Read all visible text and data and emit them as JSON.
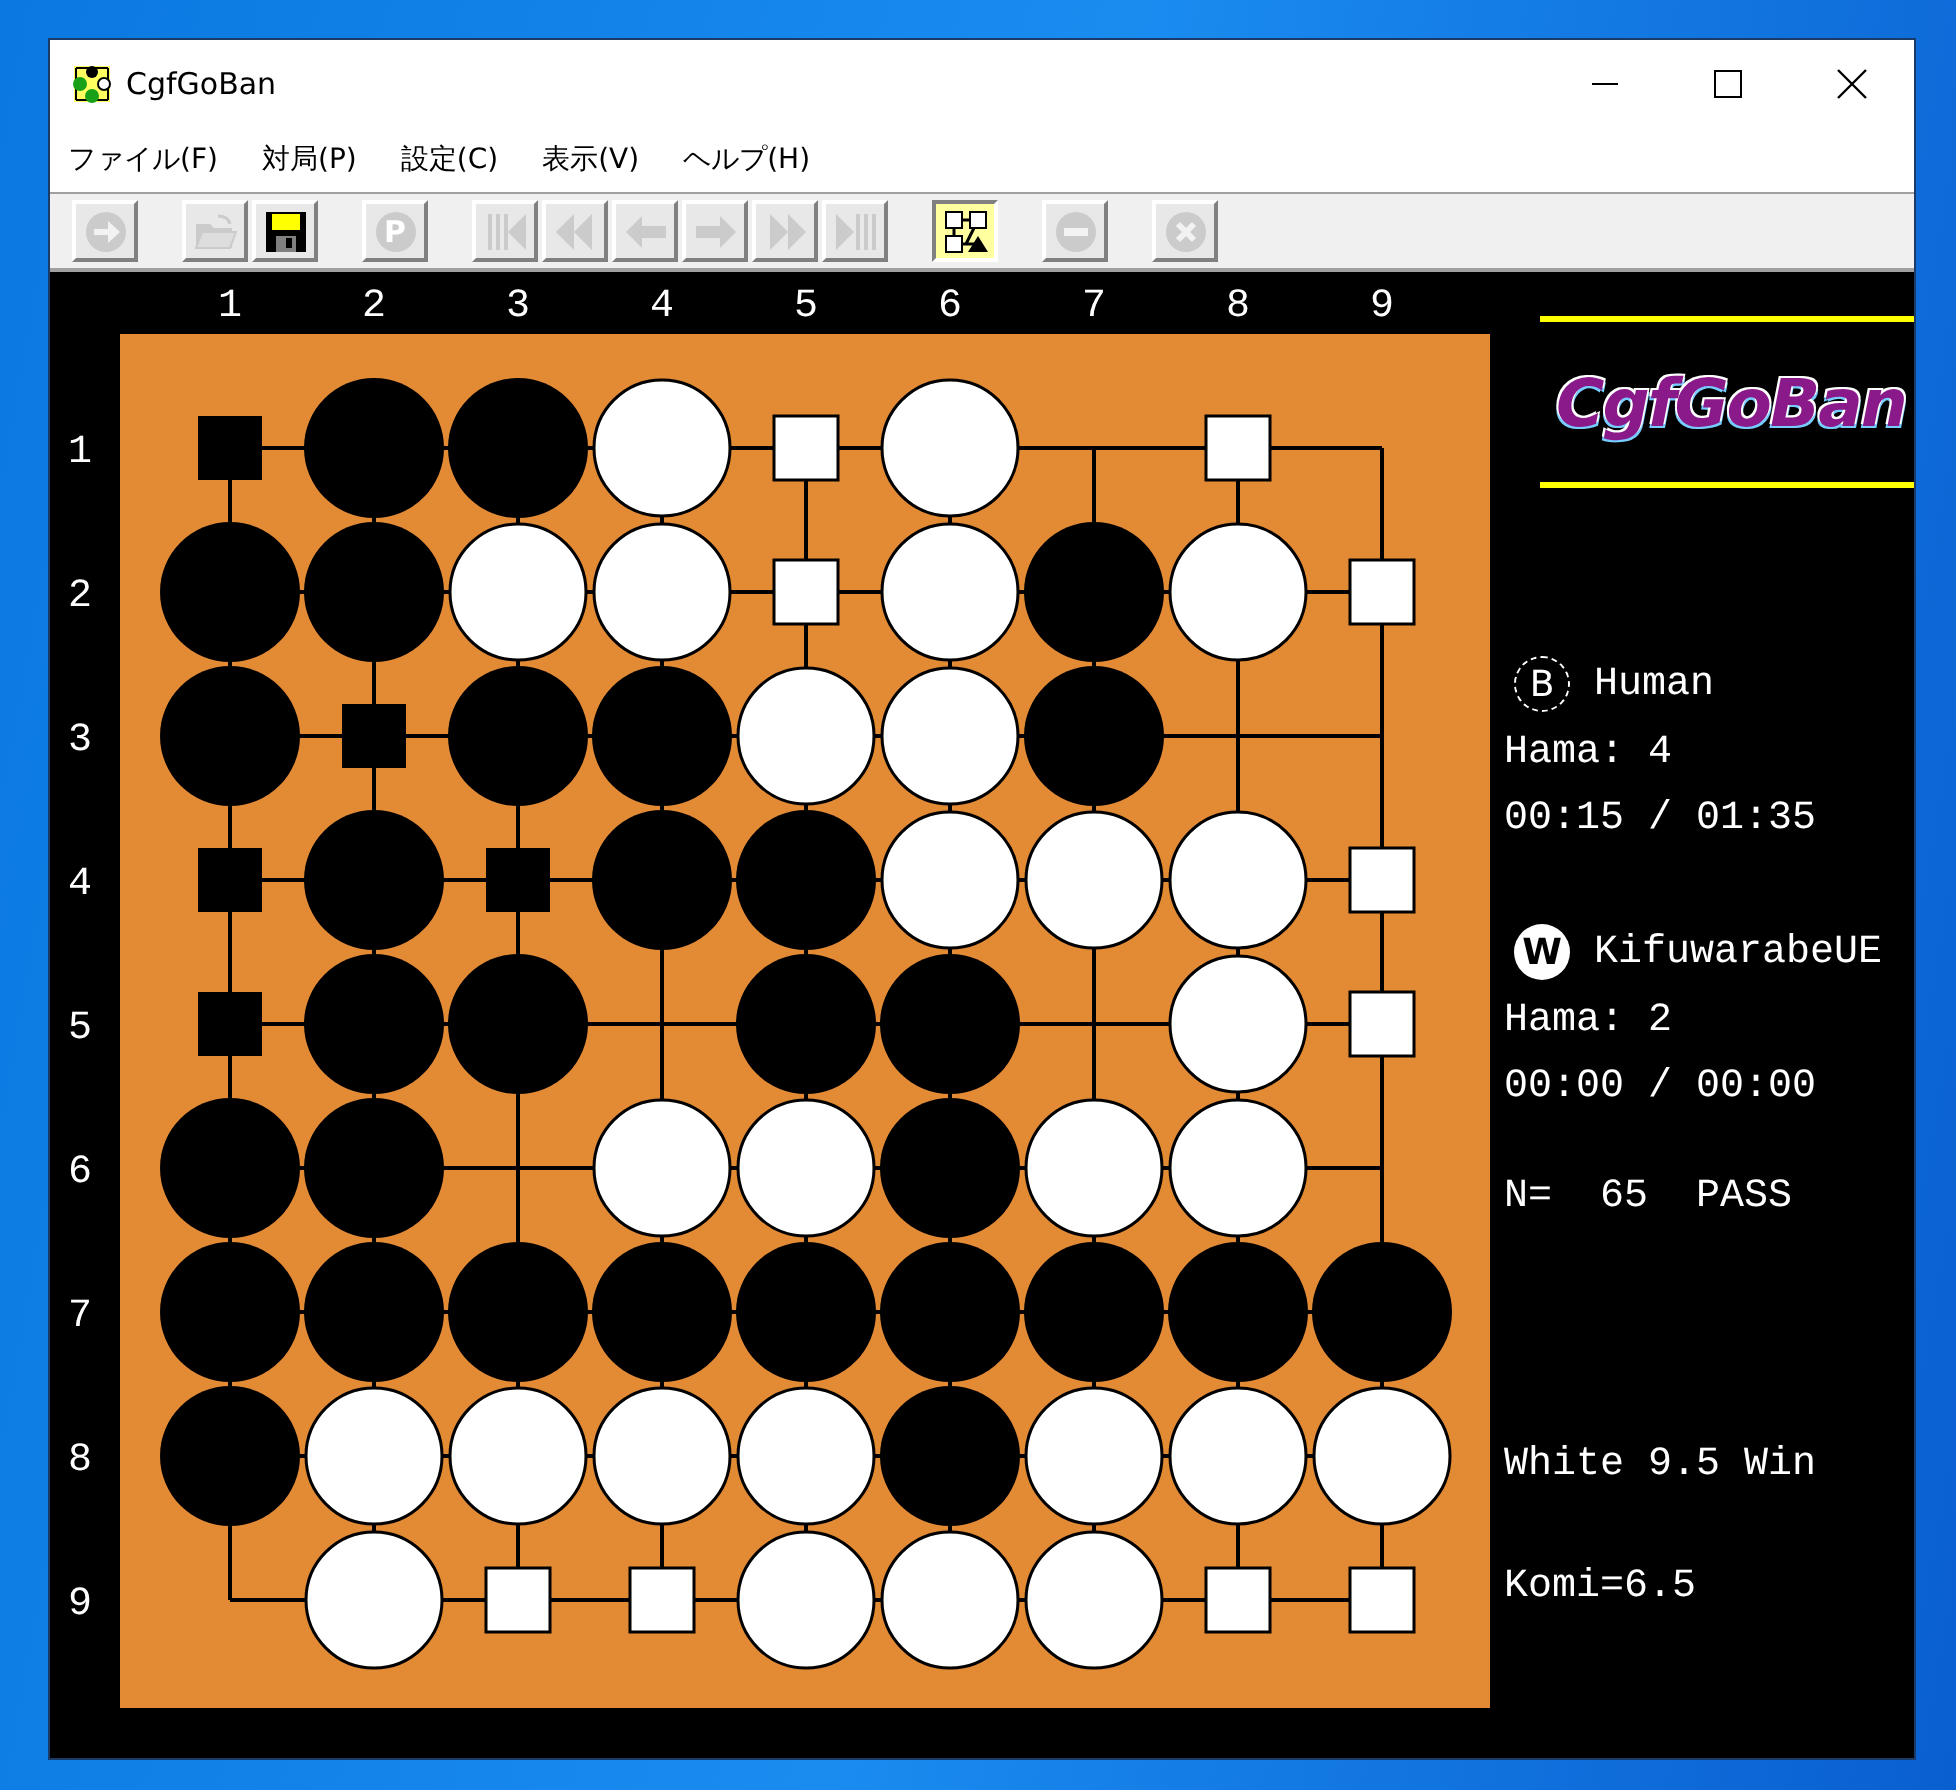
{
  "window": {
    "title": "CgfGoBan"
  },
  "menu": [
    "ファイル(F)",
    "対局(P)",
    "設定(C)",
    "表示(V)",
    "ヘルプ(H)"
  ],
  "toolbar": [
    [
      {
        "kind": "play",
        "disabled": true,
        "pressed": false
      }
    ],
    [
      {
        "kind": "open",
        "disabled": true,
        "pressed": false
      },
      {
        "kind": "save",
        "disabled": false,
        "pressed": false
      }
    ],
    [
      {
        "kind": "pass",
        "label": "P",
        "disabled": true,
        "pressed": false
      }
    ],
    [
      {
        "kind": "first",
        "disabled": true,
        "pressed": false
      },
      {
        "kind": "back-fast",
        "disabled": true,
        "pressed": false
      },
      {
        "kind": "back",
        "disabled": true,
        "pressed": false
      },
      {
        "kind": "forward",
        "disabled": true,
        "pressed": false
      },
      {
        "kind": "forward-fast",
        "disabled": true,
        "pressed": false
      },
      {
        "kind": "last",
        "disabled": true,
        "pressed": false
      }
    ],
    [
      {
        "kind": "score",
        "disabled": false,
        "pressed": true
      }
    ],
    [
      {
        "kind": "resign",
        "disabled": true,
        "pressed": false
      }
    ],
    [
      {
        "kind": "stop",
        "disabled": true,
        "pressed": false
      }
    ]
  ],
  "board": {
    "column_labels": [
      "1",
      "2",
      "3",
      "4",
      "5",
      "6",
      "7",
      "8",
      "9"
    ],
    "rows": [
      {
        "label": "1",
        "points": [
          {
            "kind": "territory",
            "black": true
          },
          {
            "kind": "stone",
            "black": true
          },
          {
            "kind": "stone",
            "black": true
          },
          {
            "kind": "stone",
            "black": false
          },
          {
            "kind": "territory",
            "black": false
          },
          {
            "kind": "stone",
            "black": false
          },
          {
            "kind": "empty"
          },
          {
            "kind": "territory",
            "black": false
          },
          {
            "kind": "empty"
          }
        ]
      },
      {
        "label": "2",
        "points": [
          {
            "kind": "stone",
            "black": true
          },
          {
            "kind": "stone",
            "black": true
          },
          {
            "kind": "stone",
            "black": false
          },
          {
            "kind": "stone",
            "black": false
          },
          {
            "kind": "territory",
            "black": false
          },
          {
            "kind": "stone",
            "black": false
          },
          {
            "kind": "stone",
            "black": true
          },
          {
            "kind": "stone",
            "black": false
          },
          {
            "kind": "territory",
            "black": false
          }
        ]
      },
      {
        "label": "3",
        "points": [
          {
            "kind": "stone",
            "black": true
          },
          {
            "kind": "territory",
            "black": true
          },
          {
            "kind": "stone",
            "black": true
          },
          {
            "kind": "stone",
            "black": true
          },
          {
            "kind": "stone",
            "black": false
          },
          {
            "kind": "stone",
            "black": false
          },
          {
            "kind": "stone",
            "black": true
          },
          {
            "kind": "empty"
          },
          {
            "kind": "empty"
          }
        ]
      },
      {
        "label": "4",
        "points": [
          {
            "kind": "territory",
            "black": true
          },
          {
            "kind": "stone",
            "black": true
          },
          {
            "kind": "territory",
            "black": true
          },
          {
            "kind": "stone",
            "black": true
          },
          {
            "kind": "stone",
            "black": true
          },
          {
            "kind": "stone",
            "black": false
          },
          {
            "kind": "stone",
            "black": false
          },
          {
            "kind": "stone",
            "black": false
          },
          {
            "kind": "territory",
            "black": false
          }
        ]
      },
      {
        "label": "5",
        "points": [
          {
            "kind": "territory",
            "black": true
          },
          {
            "kind": "stone",
            "black": true
          },
          {
            "kind": "stone",
            "black": true
          },
          {
            "kind": "empty"
          },
          {
            "kind": "stone",
            "black": true
          },
          {
            "kind": "stone",
            "black": true
          },
          {
            "kind": "empty"
          },
          {
            "kind": "stone",
            "black": false
          },
          {
            "kind": "territory",
            "black": false
          }
        ]
      },
      {
        "label": "6",
        "points": [
          {
            "kind": "stone",
            "black": true
          },
          {
            "kind": "stone",
            "black": true
          },
          {
            "kind": "empty"
          },
          {
            "kind": "stone",
            "black": false
          },
          {
            "kind": "stone",
            "black": false
          },
          {
            "kind": "stone",
            "black": true
          },
          {
            "kind": "stone",
            "black": false
          },
          {
            "kind": "stone",
            "black": false
          },
          {
            "kind": "empty"
          }
        ]
      },
      {
        "label": "7",
        "points": [
          {
            "kind": "stone",
            "black": true
          },
          {
            "kind": "stone",
            "black": true
          },
          {
            "kind": "stone",
            "black": true
          },
          {
            "kind": "stone",
            "black": true
          },
          {
            "kind": "stone",
            "black": true
          },
          {
            "kind": "stone",
            "black": true
          },
          {
            "kind": "stone",
            "black": true
          },
          {
            "kind": "stone",
            "black": true
          },
          {
            "kind": "stone",
            "black": true
          }
        ]
      },
      {
        "label": "8",
        "points": [
          {
            "kind": "stone",
            "black": true
          },
          {
            "kind": "stone",
            "black": false
          },
          {
            "kind": "stone",
            "black": false
          },
          {
            "kind": "stone",
            "black": false
          },
          {
            "kind": "stone",
            "black": false
          },
          {
            "kind": "stone",
            "black": true
          },
          {
            "kind": "stone",
            "black": false
          },
          {
            "kind": "stone",
            "black": false
          },
          {
            "kind": "stone",
            "black": false
          }
        ]
      },
      {
        "label": "9",
        "points": [
          {
            "kind": "empty"
          },
          {
            "kind": "stone",
            "black": false
          },
          {
            "kind": "territory",
            "black": false
          },
          {
            "kind": "territory",
            "black": false
          },
          {
            "kind": "stone",
            "black": false
          },
          {
            "kind": "stone",
            "black": false
          },
          {
            "kind": "stone",
            "black": false
          },
          {
            "kind": "territory",
            "black": false
          },
          {
            "kind": "territory",
            "black": false
          }
        ]
      }
    ]
  },
  "panel": {
    "logo": "CgfGoBan",
    "players": [
      {
        "black": true,
        "badge": "B",
        "name": "Human",
        "hama": "Hama: 4",
        "time": "00:15 / 01:35"
      },
      {
        "black": false,
        "badge": "W",
        "name": "KifuwarabeUE",
        "hama": "Hama: 2",
        "time": "00:00 / 00:00"
      }
    ],
    "move": "N=  65  PASS",
    "result": "White 9.5 Win",
    "komi": "Komi=6.5"
  }
}
